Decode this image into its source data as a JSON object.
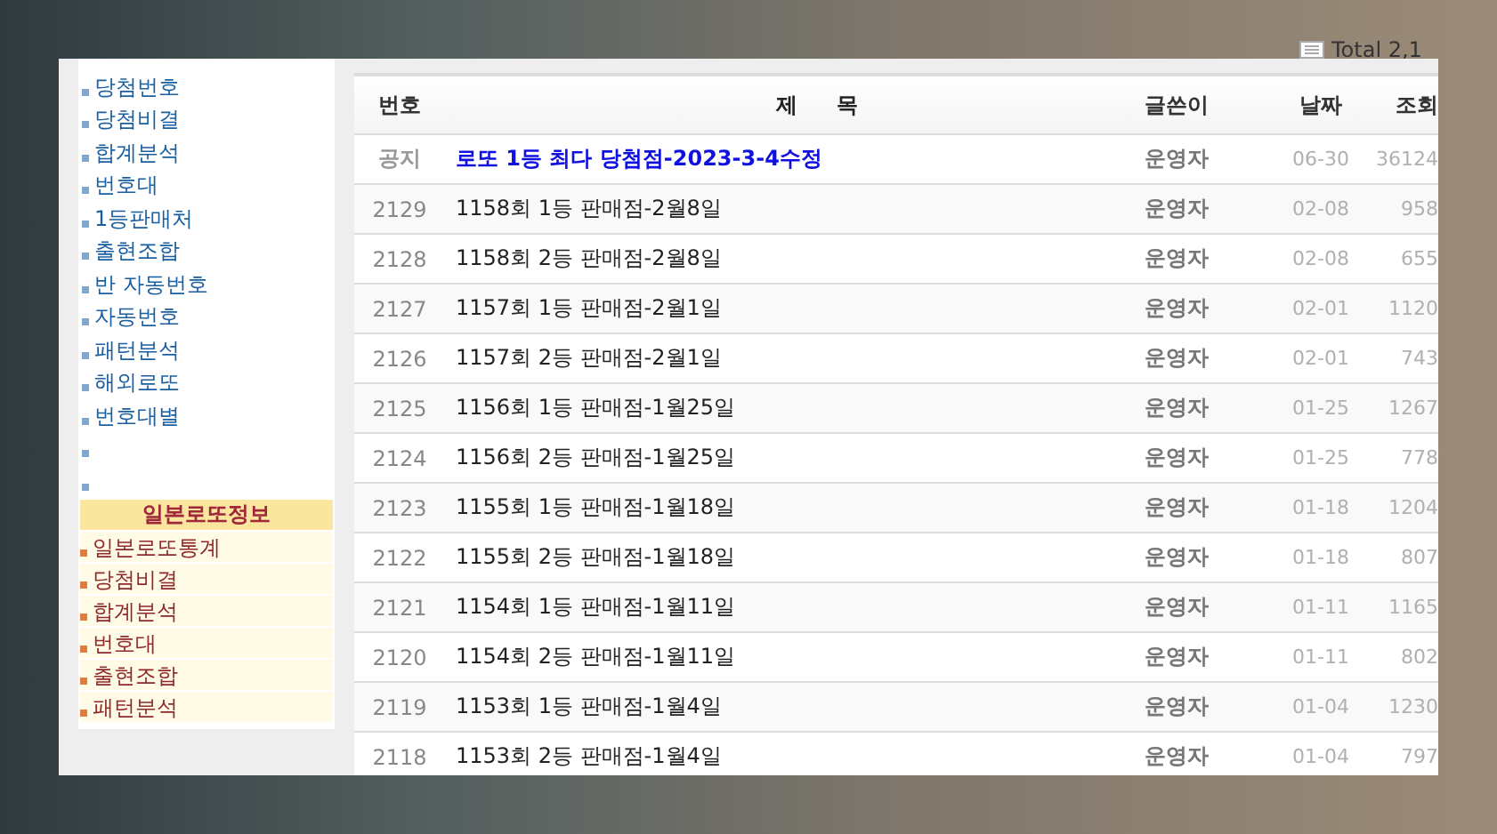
{
  "total_label": "Total 2,1",
  "sidebar": {
    "items": [
      {
        "kind": "link",
        "label": "당첨번호"
      },
      {
        "kind": "link",
        "label": "당첨비결"
      },
      {
        "kind": "link",
        "label": "합계분석"
      },
      {
        "kind": "link",
        "label": "번호대"
      },
      {
        "kind": "link",
        "label": "1등판매처"
      },
      {
        "kind": "link",
        "label": "출현조합"
      },
      {
        "kind": "link",
        "label": "반 자동번호"
      },
      {
        "kind": "link",
        "label": "자동번호"
      },
      {
        "kind": "link",
        "label": "패턴분석"
      },
      {
        "kind": "link",
        "label": "해외로또"
      },
      {
        "kind": "link",
        "label": "번호대별"
      },
      {
        "kind": "empty"
      },
      {
        "kind": "empty"
      }
    ],
    "section": {
      "title": "일본로또정보",
      "items": [
        "일본로또통계",
        "당첨비결",
        "합계분석",
        "번호대",
        "출현조합",
        "패턴분석"
      ]
    }
  },
  "table": {
    "columns": [
      "번호",
      "제 목",
      "글쓴이",
      "날짜",
      "조회"
    ],
    "rows": [
      {
        "kind": "notice",
        "number": "공지",
        "title": "로또 1등 최다 당첨점-2023-3-4수정",
        "author": "운영자",
        "date": "06-30",
        "views": "36124"
      },
      {
        "kind": "post",
        "number": "2129",
        "title": "1158회 1등 판매점-2월8일",
        "author": "운영자",
        "date": "02-08",
        "views": "958"
      },
      {
        "kind": "post",
        "number": "2128",
        "title": "1158회 2등 판매점-2월8일",
        "author": "운영자",
        "date": "02-08",
        "views": "655"
      },
      {
        "kind": "post",
        "number": "2127",
        "title": "1157회 1등 판매점-2월1일",
        "author": "운영자",
        "date": "02-01",
        "views": "1120"
      },
      {
        "kind": "post",
        "number": "2126",
        "title": "1157회 2등 판매점-2월1일",
        "author": "운영자",
        "date": "02-01",
        "views": "743"
      },
      {
        "kind": "post",
        "number": "2125",
        "title": "1156회 1등 판매점-1월25일",
        "author": "운영자",
        "date": "01-25",
        "views": "1267"
      },
      {
        "kind": "post",
        "number": "2124",
        "title": "1156회 2등 판매점-1월25일",
        "author": "운영자",
        "date": "01-25",
        "views": "778"
      },
      {
        "kind": "post",
        "number": "2123",
        "title": "1155회 1등 판매점-1월18일",
        "author": "운영자",
        "date": "01-18",
        "views": "1204"
      },
      {
        "kind": "post",
        "number": "2122",
        "title": "1155회 2등 판매점-1월18일",
        "author": "운영자",
        "date": "01-18",
        "views": "807"
      },
      {
        "kind": "post",
        "number": "2121",
        "title": "1154회 1등 판매점-1월11일",
        "author": "운영자",
        "date": "01-11",
        "views": "1165"
      },
      {
        "kind": "post",
        "number": "2120",
        "title": "1154회 2등 판매점-1월11일",
        "author": "운영자",
        "date": "01-11",
        "views": "802"
      },
      {
        "kind": "post",
        "number": "2119",
        "title": "1153회 1등 판매점-1월4일",
        "author": "운영자",
        "date": "01-04",
        "views": "1230"
      },
      {
        "kind": "post",
        "number": "2118",
        "title": "1153회 2등 판매점-1월4일",
        "author": "운영자",
        "date": "01-04",
        "views": "797"
      }
    ]
  }
}
